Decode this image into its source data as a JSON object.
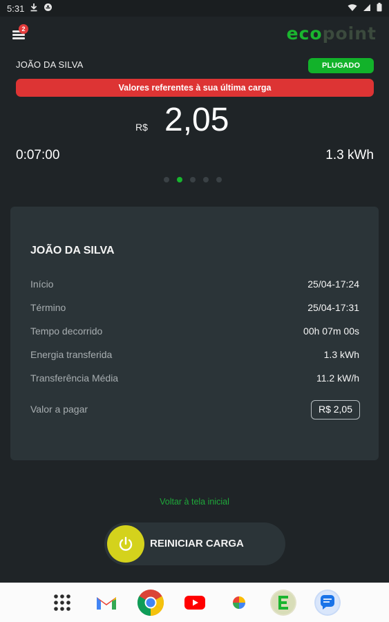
{
  "status_bar": {
    "time": "5:31"
  },
  "header": {
    "menu_badge": "2",
    "logo_eco": "eco",
    "logo_point": "point"
  },
  "session": {
    "user_name": "JOÃO DA SILVA",
    "status_badge": "PLUGADO",
    "alert": "Valores referentes à sua última carga",
    "currency": "R$",
    "amount": "2,05",
    "elapsed": "0:07:00",
    "energy": "1.3 kWh",
    "pager": {
      "count": 5,
      "active": 1
    }
  },
  "summary": {
    "title": "JOÃO DA SILVA",
    "rows": [
      {
        "label": "Início",
        "value": "25/04-17:24"
      },
      {
        "label": "Término",
        "value": "25/04-17:31"
      },
      {
        "label": "Tempo decorrido",
        "value": "00h 07m 00s"
      },
      {
        "label": "Energia transferida",
        "value": "1.3 kWh"
      },
      {
        "label": "Transferência Média",
        "value": "11.2 kW/h"
      }
    ],
    "pay_label": "Valor a pagar",
    "pay_value": "R$ 2,05"
  },
  "actions": {
    "back_link": "Voltar à tela inicial",
    "restart_label": "REINICIAR CARGA"
  },
  "colors": {
    "accent_green": "#17b52e",
    "alert_red": "#dd3434",
    "power_yellow": "#d4d21c"
  },
  "dock": [
    "apps-grid-icon",
    "gmail-icon",
    "chrome-icon",
    "youtube-icon",
    "photos-icon",
    "ecopoint-icon",
    "messages-icon"
  ]
}
